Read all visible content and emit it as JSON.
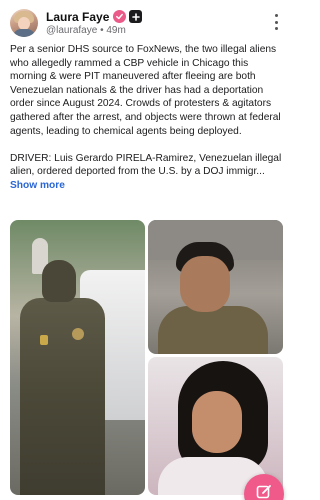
{
  "post": {
    "author": {
      "display_name": "Laura Faye",
      "handle": "@laurafaye",
      "time_ago": "49m",
      "separator": "•"
    },
    "body": {
      "paragraph_1": "Per a senior DHS source to FoxNews, the two illegal aliens who allegedly rammed a CBP vehicle in Chicago this morning & were PIT maneuvered after fleeing are both Venezuelan nationals & the driver has had a deportation order since August 2024. Crowds of protesters & agitators gathered after the arrest, and objects were thrown at federal agents, leading to chemical agents being deployed.",
      "paragraph_2": "DRIVER: Luis Gerardo PIRELA-Ramirez, Venezuelan illegal alien, ordered deported from the U.S. by a DOJ immigr...",
      "show_more_label": "Show more"
    },
    "media_count": 3
  },
  "icons": {
    "verified": "verified-badge-icon",
    "plus": "plus-icon",
    "more": "more-vertical-icon",
    "compose": "compose-icon"
  },
  "colors": {
    "accent": "#ef5a8b",
    "link": "#2a66d4",
    "verified": "#ea5b8a"
  }
}
